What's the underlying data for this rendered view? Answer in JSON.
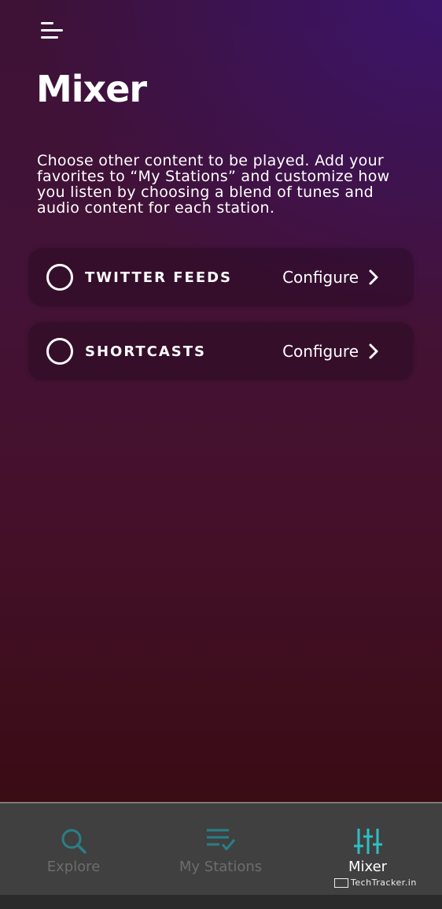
{
  "page": {
    "title": "Mixer",
    "description": "Choose other content to be played. Add your favorites to “My Stations” and customize how you listen by choosing a blend of tunes and audio content for each station."
  },
  "header": {
    "menu_icon": "menu-icon"
  },
  "cards": [
    {
      "label": "TWITTER FEEDS",
      "action": "Configure",
      "selected": false
    },
    {
      "label": "SHORTCASTS",
      "action": "Configure",
      "selected": false
    }
  ],
  "nav": {
    "items": [
      {
        "label": "Explore",
        "icon": "search-icon",
        "active": false
      },
      {
        "label": "My Stations",
        "icon": "list-check-icon",
        "active": false
      },
      {
        "label": "Mixer",
        "icon": "sliders-icon",
        "active": true
      }
    ]
  },
  "watermark": {
    "text": "TechTracker.in"
  },
  "colors": {
    "accent": "#2fbfc4",
    "inactive": "#6d6d6d",
    "nav_bg": "#404040"
  }
}
